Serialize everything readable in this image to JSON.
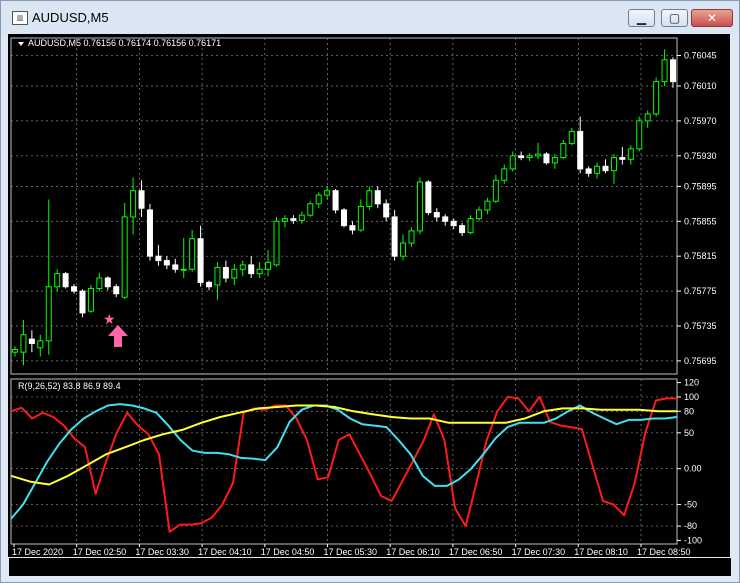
{
  "window": {
    "title": "AUDUSD,M5",
    "buttons": {
      "minimize": "▁",
      "maximize": "▢",
      "close": "✕"
    }
  },
  "main_header": "AUDUSD,M5  0.76156 0.76174 0.76156 0.76171",
  "indicator_header": "R(9,26,52) 83.8 86.9 89.4",
  "price_axis": [
    "0.76045",
    "0.76010",
    "0.75970",
    "0.75930",
    "0.75895",
    "0.75855",
    "0.75815",
    "0.75775",
    "0.75735",
    "0.75695"
  ],
  "indicator_axis": [
    "120",
    "100",
    "80",
    "50",
    "0.00",
    "-50",
    "-80",
    "-100"
  ],
  "time_axis": [
    "17 Dec 2020",
    "17 Dec 02:50",
    "17 Dec 03:30",
    "17 Dec 04:10",
    "17 Dec 04:50",
    "17 Dec 05:30",
    "17 Dec 06:10",
    "17 Dec 06:50",
    "17 Dec 07:30",
    "17 Dec 08:10",
    "17 Dec 08:50"
  ],
  "markers": {
    "star": "★",
    "arrow": "up-arrow-icon"
  },
  "colors": {
    "background": "#000000",
    "bull": "#00ff00",
    "bear": "#ffffff",
    "red": "#ff1a1a",
    "cyan": "#40e0f0",
    "yellow": "#ffff33",
    "marker": "#ff66aa",
    "grid": "#8c8c8c"
  },
  "chart_data": [
    {
      "type": "candlestick",
      "symbol": "AUDUSD",
      "timeframe": "M5",
      "ylim": [
        0.7568,
        0.76065
      ],
      "y_ticks": [
        0.76045,
        0.7601,
        0.7597,
        0.7593,
        0.75895,
        0.75855,
        0.75815,
        0.75775,
        0.75735,
        0.75695
      ],
      "candles": [
        {
          "o": 0.75705,
          "h": 0.75712,
          "l": 0.757,
          "c": 0.75708
        },
        {
          "o": 0.75705,
          "h": 0.75742,
          "l": 0.7569,
          "c": 0.75725
        },
        {
          "o": 0.7572,
          "h": 0.7573,
          "l": 0.75705,
          "c": 0.75715
        },
        {
          "o": 0.7571,
          "h": 0.75725,
          "l": 0.757,
          "c": 0.75718
        },
        {
          "o": 0.75718,
          "h": 0.7588,
          "l": 0.75702,
          "c": 0.7578
        },
        {
          "o": 0.7578,
          "h": 0.758,
          "l": 0.75775,
          "c": 0.75795
        },
        {
          "o": 0.75795,
          "h": 0.75797,
          "l": 0.75778,
          "c": 0.7578
        },
        {
          "o": 0.7578,
          "h": 0.75783,
          "l": 0.75772,
          "c": 0.75775
        },
        {
          "o": 0.75775,
          "h": 0.75777,
          "l": 0.75745,
          "c": 0.7575
        },
        {
          "o": 0.75752,
          "h": 0.75782,
          "l": 0.7575,
          "c": 0.75778
        },
        {
          "o": 0.75778,
          "h": 0.75796,
          "l": 0.75775,
          "c": 0.7579
        },
        {
          "o": 0.7579,
          "h": 0.75792,
          "l": 0.75776,
          "c": 0.7578
        },
        {
          "o": 0.7578,
          "h": 0.75783,
          "l": 0.75768,
          "c": 0.75772
        },
        {
          "o": 0.75768,
          "h": 0.75876,
          "l": 0.75766,
          "c": 0.7586
        },
        {
          "o": 0.7586,
          "h": 0.75905,
          "l": 0.7584,
          "c": 0.7589
        },
        {
          "o": 0.7589,
          "h": 0.75902,
          "l": 0.7586,
          "c": 0.7587
        },
        {
          "o": 0.75868,
          "h": 0.75875,
          "l": 0.7581,
          "c": 0.75815
        },
        {
          "o": 0.75815,
          "h": 0.75828,
          "l": 0.75804,
          "c": 0.7581
        },
        {
          "o": 0.7581,
          "h": 0.75815,
          "l": 0.758,
          "c": 0.75805
        },
        {
          "o": 0.75805,
          "h": 0.75812,
          "l": 0.75796,
          "c": 0.758
        },
        {
          "o": 0.758,
          "h": 0.75836,
          "l": 0.7579,
          "c": 0.758
        },
        {
          "o": 0.758,
          "h": 0.75845,
          "l": 0.75797,
          "c": 0.75835
        },
        {
          "o": 0.75835,
          "h": 0.7585,
          "l": 0.7578,
          "c": 0.75785
        },
        {
          "o": 0.75785,
          "h": 0.75787,
          "l": 0.75776,
          "c": 0.7578
        },
        {
          "o": 0.75782,
          "h": 0.75808,
          "l": 0.75765,
          "c": 0.75802
        },
        {
          "o": 0.75802,
          "h": 0.7581,
          "l": 0.75785,
          "c": 0.7579
        },
        {
          "o": 0.7579,
          "h": 0.75806,
          "l": 0.75782,
          "c": 0.758
        },
        {
          "o": 0.758,
          "h": 0.7581,
          "l": 0.75792,
          "c": 0.75805
        },
        {
          "o": 0.75805,
          "h": 0.75815,
          "l": 0.7579,
          "c": 0.75795
        },
        {
          "o": 0.75795,
          "h": 0.75808,
          "l": 0.7579,
          "c": 0.758
        },
        {
          "o": 0.758,
          "h": 0.75822,
          "l": 0.75792,
          "c": 0.75808
        },
        {
          "o": 0.75805,
          "h": 0.7586,
          "l": 0.75803,
          "c": 0.75855
        },
        {
          "o": 0.75855,
          "h": 0.75862,
          "l": 0.75848,
          "c": 0.75858
        },
        {
          "o": 0.75858,
          "h": 0.75862,
          "l": 0.75852,
          "c": 0.75856
        },
        {
          "o": 0.75856,
          "h": 0.75866,
          "l": 0.75852,
          "c": 0.75862
        },
        {
          "o": 0.75862,
          "h": 0.75878,
          "l": 0.7586,
          "c": 0.75875
        },
        {
          "o": 0.75875,
          "h": 0.75888,
          "l": 0.7587,
          "c": 0.75885
        },
        {
          "o": 0.75885,
          "h": 0.75895,
          "l": 0.7588,
          "c": 0.7589
        },
        {
          "o": 0.7589,
          "h": 0.75892,
          "l": 0.75864,
          "c": 0.75868
        },
        {
          "o": 0.75868,
          "h": 0.7587,
          "l": 0.75848,
          "c": 0.7585
        },
        {
          "o": 0.7585,
          "h": 0.75855,
          "l": 0.7584,
          "c": 0.75845
        },
        {
          "o": 0.75845,
          "h": 0.7588,
          "l": 0.75843,
          "c": 0.75872
        },
        {
          "o": 0.75872,
          "h": 0.75895,
          "l": 0.75868,
          "c": 0.7589
        },
        {
          "o": 0.7589,
          "h": 0.75895,
          "l": 0.7587,
          "c": 0.75875
        },
        {
          "o": 0.75875,
          "h": 0.7588,
          "l": 0.75855,
          "c": 0.7586
        },
        {
          "o": 0.7586,
          "h": 0.75868,
          "l": 0.7581,
          "c": 0.75815
        },
        {
          "o": 0.75815,
          "h": 0.7584,
          "l": 0.7581,
          "c": 0.7583
        },
        {
          "o": 0.7583,
          "h": 0.75848,
          "l": 0.75826,
          "c": 0.75844
        },
        {
          "o": 0.75844,
          "h": 0.75905,
          "l": 0.7584,
          "c": 0.759
        },
        {
          "o": 0.759,
          "h": 0.75902,
          "l": 0.75862,
          "c": 0.75865
        },
        {
          "o": 0.75865,
          "h": 0.7587,
          "l": 0.75855,
          "c": 0.7586
        },
        {
          "o": 0.7586,
          "h": 0.75863,
          "l": 0.7585,
          "c": 0.75855
        },
        {
          "o": 0.75855,
          "h": 0.75858,
          "l": 0.75846,
          "c": 0.7585
        },
        {
          "o": 0.7585,
          "h": 0.75853,
          "l": 0.75838,
          "c": 0.75842
        },
        {
          "o": 0.75842,
          "h": 0.75862,
          "l": 0.7584,
          "c": 0.75858
        },
        {
          "o": 0.75858,
          "h": 0.75872,
          "l": 0.75855,
          "c": 0.75868
        },
        {
          "o": 0.75868,
          "h": 0.75882,
          "l": 0.75863,
          "c": 0.75878
        },
        {
          "o": 0.75878,
          "h": 0.75908,
          "l": 0.75876,
          "c": 0.75902
        },
        {
          "o": 0.75902,
          "h": 0.7592,
          "l": 0.75898,
          "c": 0.75915
        },
        {
          "o": 0.75915,
          "h": 0.75935,
          "l": 0.75912,
          "c": 0.7593
        },
        {
          "o": 0.7593,
          "h": 0.75935,
          "l": 0.75925,
          "c": 0.75928
        },
        {
          "o": 0.75928,
          "h": 0.75933,
          "l": 0.75924,
          "c": 0.7593
        },
        {
          "o": 0.7593,
          "h": 0.75945,
          "l": 0.75926,
          "c": 0.75932
        },
        {
          "o": 0.75932,
          "h": 0.75934,
          "l": 0.7592,
          "c": 0.75922
        },
        {
          "o": 0.75922,
          "h": 0.75932,
          "l": 0.75915,
          "c": 0.75928
        },
        {
          "o": 0.75928,
          "h": 0.75948,
          "l": 0.75926,
          "c": 0.75944
        },
        {
          "o": 0.75944,
          "h": 0.75962,
          "l": 0.75942,
          "c": 0.75958
        },
        {
          "o": 0.75958,
          "h": 0.75975,
          "l": 0.7591,
          "c": 0.75915
        },
        {
          "o": 0.75915,
          "h": 0.75918,
          "l": 0.75906,
          "c": 0.7591
        },
        {
          "o": 0.7591,
          "h": 0.75922,
          "l": 0.75904,
          "c": 0.75918
        },
        {
          "o": 0.75918,
          "h": 0.75926,
          "l": 0.7591,
          "c": 0.75913
        },
        {
          "o": 0.75913,
          "h": 0.75932,
          "l": 0.75898,
          "c": 0.75928
        },
        {
          "o": 0.75928,
          "h": 0.7594,
          "l": 0.7592,
          "c": 0.75926
        },
        {
          "o": 0.75926,
          "h": 0.75942,
          "l": 0.7592,
          "c": 0.75938
        },
        {
          "o": 0.75938,
          "h": 0.75975,
          "l": 0.75935,
          "c": 0.7597
        },
        {
          "o": 0.7597,
          "h": 0.75982,
          "l": 0.75962,
          "c": 0.75978
        },
        {
          "o": 0.75978,
          "h": 0.7602,
          "l": 0.75975,
          "c": 0.76015
        },
        {
          "o": 0.76015,
          "h": 0.76052,
          "l": 0.7601,
          "c": 0.7604
        },
        {
          "o": 0.7604,
          "h": 0.76043,
          "l": 0.76008,
          "c": 0.76015
        }
      ]
    },
    {
      "type": "line",
      "name": "R(9,26,52)",
      "ylim": [
        -105,
        125
      ],
      "y_ticks": [
        120,
        100,
        80,
        50,
        0,
        -50,
        -80,
        -100
      ],
      "last_values": [
        83.8,
        86.9,
        89.4
      ],
      "series": [
        {
          "name": "R 9",
          "color": "#ff1a1a",
          "values": [
            80,
            85,
            70,
            78,
            72,
            60,
            42,
            30,
            -35,
            10,
            50,
            78,
            60,
            48,
            20,
            -88,
            -78,
            -78,
            -76,
            -68,
            -50,
            -20,
            78,
            84,
            82,
            88,
            88,
            70,
            40,
            -15,
            -12,
            40,
            48,
            20,
            -8,
            -38,
            -45,
            -18,
            10,
            38,
            76,
            40,
            -55,
            -80,
            -22,
            40,
            80,
            100,
            98,
            80,
            100,
            65,
            60,
            58,
            55,
            5,
            -45,
            -50,
            -65,
            -20,
            50,
            95,
            98,
            98
          ]
        },
        {
          "name": "R 26",
          "color": "#40e0f0",
          "values": [
            -70,
            -50,
            -20,
            10,
            35,
            55,
            70,
            80,
            88,
            90,
            88,
            84,
            78,
            60,
            40,
            25,
            22,
            22,
            20,
            15,
            14,
            12,
            30,
            65,
            82,
            88,
            88,
            82,
            70,
            62,
            60,
            58,
            40,
            20,
            -10,
            -24,
            -24,
            -15,
            0,
            20,
            42,
            58,
            64,
            64,
            64,
            70,
            80,
            88,
            78,
            70,
            62,
            68,
            68,
            70,
            70,
            72
          ]
        },
        {
          "name": "R 52",
          "color": "#ffff33",
          "values": [
            -10,
            -18,
            -22,
            -10,
            5,
            20,
            30,
            40,
            48,
            54,
            64,
            72,
            78,
            84,
            86,
            88,
            88,
            86,
            80,
            76,
            72,
            70,
            70,
            64,
            64,
            64,
            64,
            70,
            80,
            84,
            84,
            82,
            82,
            82,
            80,
            80
          ]
        }
      ]
    }
  ]
}
